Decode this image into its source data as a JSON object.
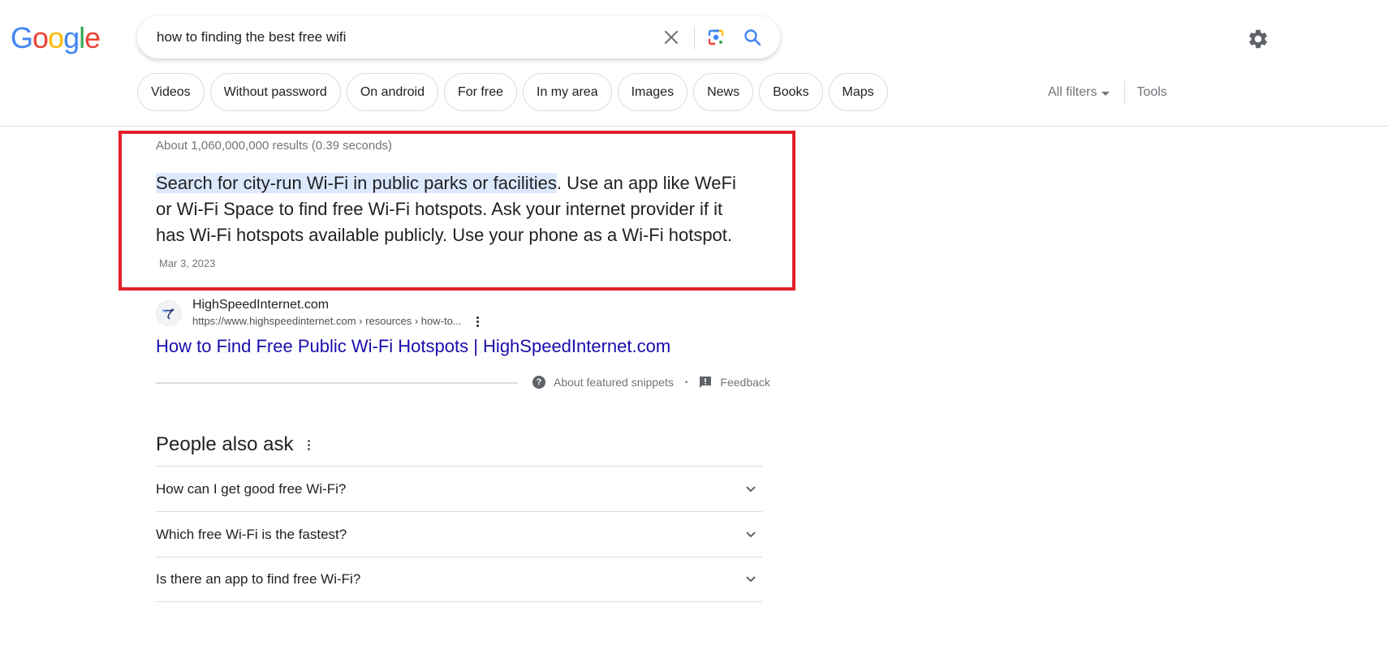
{
  "logo": {
    "letters": [
      "G",
      "o",
      "o",
      "g",
      "l",
      "e"
    ],
    "colors": [
      "#4285f4",
      "#ea4335",
      "#fbbc05",
      "#4285f4",
      "#34a853",
      "#ea4335"
    ]
  },
  "search": {
    "query": "how to finding the best free wifi",
    "clear_icon": "close-icon",
    "lens_icon": "google-lens-icon",
    "search_icon": "search-icon"
  },
  "header": {
    "settings_icon": "gear-icon"
  },
  "chips": [
    {
      "label": "Videos"
    },
    {
      "label": "Without password"
    },
    {
      "label": "On android"
    },
    {
      "label": "For free"
    },
    {
      "label": "In my area"
    },
    {
      "label": "Images"
    },
    {
      "label": "News"
    },
    {
      "label": "Books"
    },
    {
      "label": "Maps"
    }
  ],
  "filters": {
    "all_filters": "All filters",
    "tools": "Tools"
  },
  "results": {
    "stats": "About 1,060,000,000 results (0.39 seconds)"
  },
  "featured_snippet": {
    "highlighted": "Search for city-run Wi-Fi in public parks or facilities",
    "rest": ". Use an app like WeFi or Wi-Fi Space to find free Wi-Fi hotspots. Ask your internet provider if it has Wi-Fi hotspots available publicly. Use your phone as a Wi-Fi hotspot.",
    "date": "Mar 3, 2023",
    "highlight_box_color": "#e3202a",
    "source": {
      "site_name": "HighSpeedInternet.com",
      "url": "https://www.highspeedinternet.com › resources › how-to...",
      "title": "How to Find Free Public Wi-Fi Hotspots | HighSpeedInternet.com"
    },
    "footer": {
      "about": "About featured snippets",
      "separator": "•",
      "feedback": "Feedback"
    }
  },
  "people_also_ask": {
    "title": "People also ask",
    "questions": [
      {
        "text": "How can I get good free Wi-Fi?"
      },
      {
        "text": "Which free Wi-Fi is the fastest?"
      },
      {
        "text": "Is there an app to find free Wi-Fi?"
      }
    ]
  },
  "colors": {
    "link": "#1a0dab",
    "secondary_text": "#70757a",
    "selection": "#d3e3fd"
  }
}
